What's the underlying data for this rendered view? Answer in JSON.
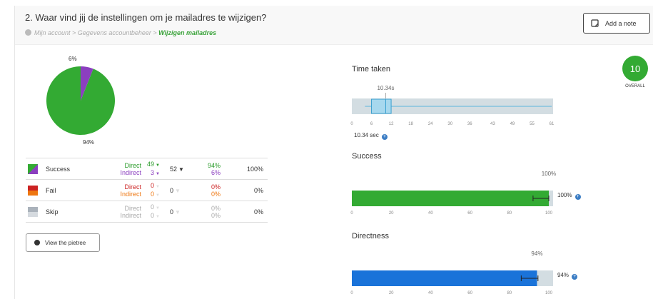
{
  "question": {
    "title": "2. Waar vind jij de instellingen om je mailadres te wijzigen?",
    "breadcrumb": [
      "Mijn account",
      "Gegevens accountbeheer",
      "Wijzigen mailadres"
    ],
    "breadcrumb_sep": " > ",
    "add_note_label": "Add a note"
  },
  "pie": {
    "top_label": "6%",
    "bottom_label": "94%",
    "success_pct": 94,
    "success_color": "#33aa33",
    "indirect_color": "#8b3fbf"
  },
  "results": [
    {
      "label": "Success",
      "direct_label": "Direct",
      "indirect_label": "Indirect",
      "direct_count": "49",
      "indirect_count": "3",
      "total": "52",
      "direct_pct": "94%",
      "indirect_pct": "6%",
      "overall": "100%"
    },
    {
      "label": "Fail",
      "direct_label": "Direct",
      "indirect_label": "Indirect",
      "direct_count": "0",
      "indirect_count": "0",
      "total": "0",
      "direct_pct": "0%",
      "indirect_pct": "0%",
      "overall": "0%"
    },
    {
      "label": "Skip",
      "direct_label": "Direct",
      "indirect_label": "Indirect",
      "direct_count": "0",
      "indirect_count": "0",
      "total": "0",
      "direct_pct": "0%",
      "indirect_pct": "0%",
      "overall": "0%"
    }
  ],
  "view_pietree_label": "View the pietree",
  "overall_score": {
    "value": "10",
    "label": "OVERALL"
  },
  "time_taken": {
    "title": "Time taken",
    "median_label": "10.34s",
    "median": 10.34,
    "box_q1": 6,
    "box_q3": 12,
    "whisker_low": 4,
    "whisker_high": 61,
    "ticks": [
      "0",
      "6",
      "12",
      "18",
      "24",
      "30",
      "36",
      "43",
      "49",
      "55",
      "61"
    ],
    "summary": "10.34 sec"
  },
  "success": {
    "title": "Success",
    "value": 100,
    "value_label": "100%",
    "side_label": "100%",
    "ticks": [
      "0",
      "20",
      "40",
      "60",
      "80",
      "100"
    ],
    "color": "#33aa33"
  },
  "directness": {
    "title": "Directness",
    "value": 94,
    "value_label": "94%",
    "side_label": "94%",
    "ticks": [
      "0",
      "20",
      "40",
      "60",
      "80",
      "100"
    ],
    "color": "#1a73d9"
  }
}
